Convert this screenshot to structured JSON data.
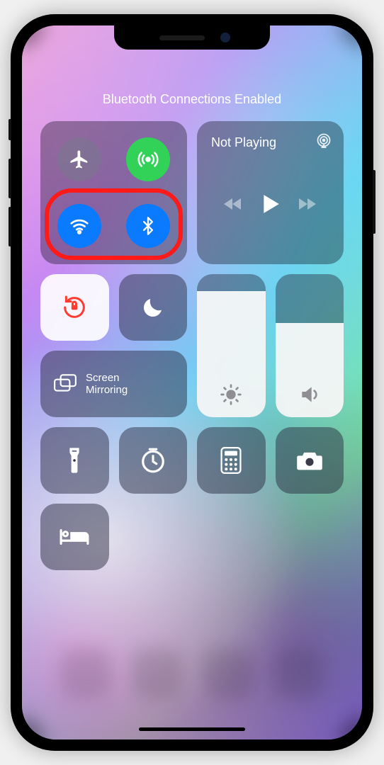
{
  "status_text": "Bluetooth Connections Enabled",
  "connectivity": {
    "airplane": {
      "on": false
    },
    "cellular": {
      "on": true
    },
    "wifi": {
      "on": true
    },
    "bluetooth": {
      "on": true
    }
  },
  "music": {
    "title": "Not Playing"
  },
  "screen_mirroring": {
    "label_line1": "Screen",
    "label_line2": "Mirroring"
  },
  "brightness": {
    "level_pct": 88
  },
  "volume": {
    "level_pct": 66
  },
  "highlight_annotation": "wifi-and-bluetooth-highlighted"
}
